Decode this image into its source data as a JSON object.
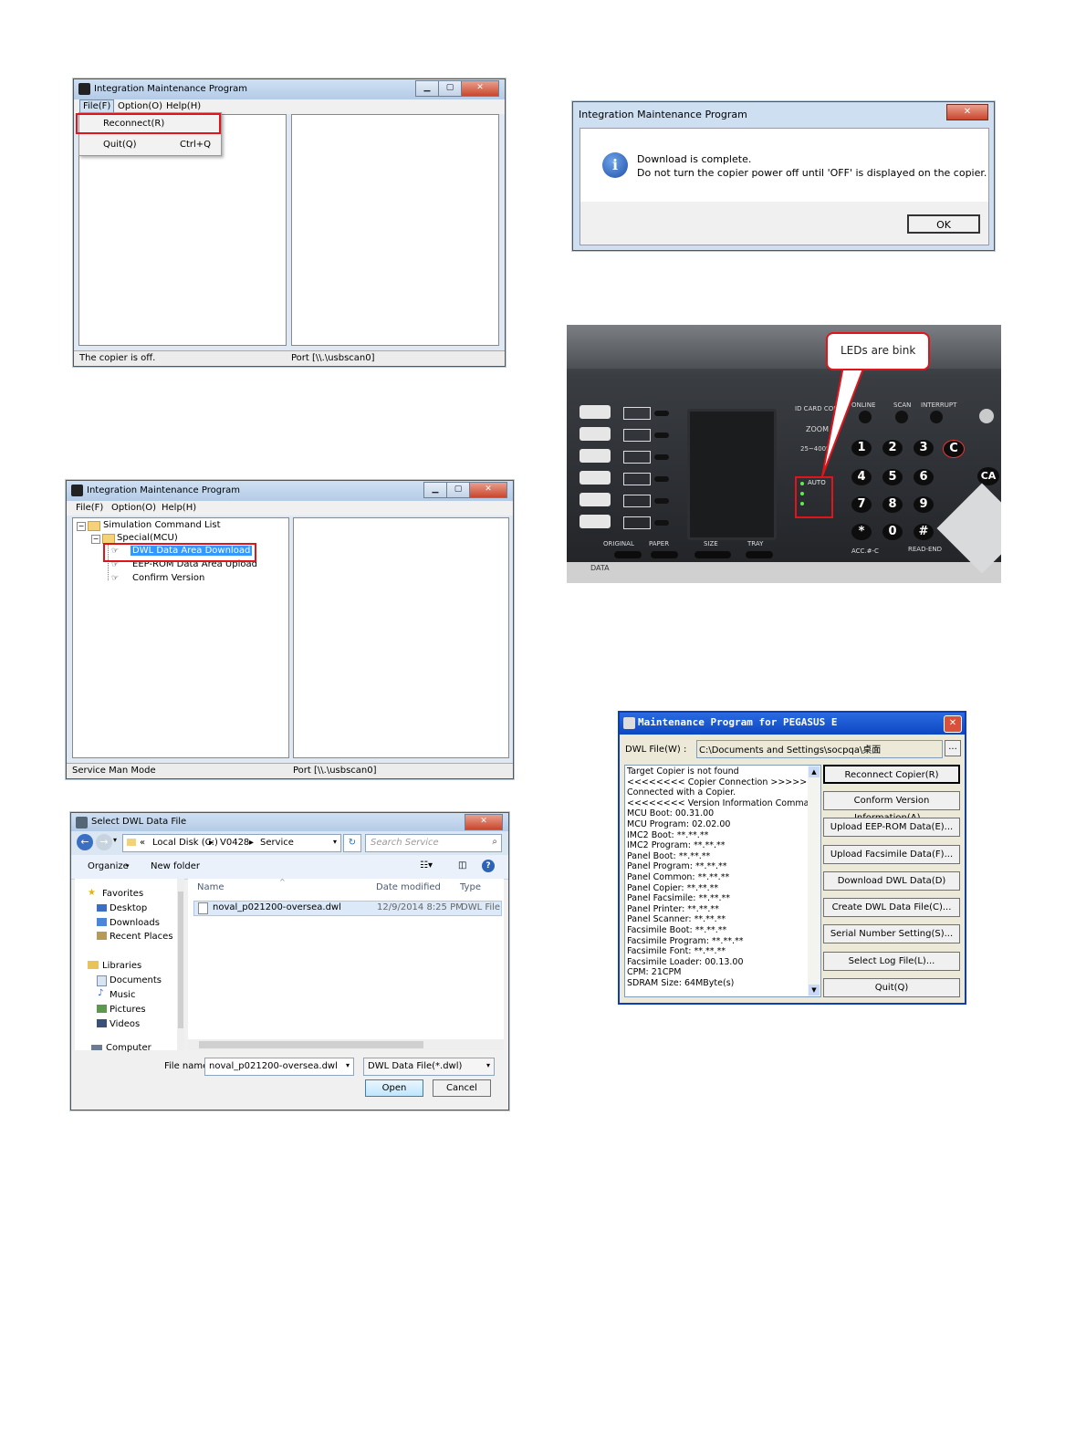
{
  "win1": {
    "title": "Integration Maintenance Program",
    "menu": {
      "file": "File(F)",
      "option": "Option(O)",
      "help": "Help(H)"
    },
    "dropdown": {
      "reconnect": "Reconnect(R)",
      "quit": "Quit(Q)",
      "quit_shortcut": "Ctrl+Q"
    },
    "status_left": "The copier is off.",
    "status_right": "Port [\\\\.\\usbscan0]"
  },
  "win2": {
    "title": "Integration Maintenance Program",
    "menu": {
      "file": "File(F)",
      "option": "Option(O)",
      "help": "Help(H)"
    },
    "tree": {
      "root": "Simulation Command List",
      "group": "Special(MCU)",
      "items": [
        "DWL Data Area Download",
        "EEP-ROM Data Area Upload",
        "Confirm Version"
      ]
    },
    "status_left": "Service Man Mode",
    "status_right": "Port [\\\\.\\usbscan0]"
  },
  "win3": {
    "title": "Select DWL Data File",
    "path": {
      "root": "«",
      "disk": "Local Disk (C:)",
      "folder1": "V0428",
      "folder2": "Service"
    },
    "search_placeholder": "Search Service",
    "organize": "Organize",
    "new_folder": "New folder",
    "nav": {
      "favorites": "Favorites",
      "favorite_items": [
        "Desktop",
        "Downloads",
        "Recent Places"
      ],
      "libraries": "Libraries",
      "library_items": [
        "Documents",
        "Music",
        "Pictures",
        "Videos"
      ],
      "computer": "Computer"
    },
    "columns": {
      "name": "Name",
      "date": "Date modified",
      "type": "Type"
    },
    "file": {
      "name": "noval_p021200-oversea.dwl",
      "date": "12/9/2014 8:25 PM",
      "type": "DWL File"
    },
    "file_name_label": "File name:",
    "file_name_value": "noval_p021200-oversea.dwl",
    "filter": "DWL Data File(*.dwl)",
    "open": "Open",
    "cancel": "Cancel"
  },
  "dialog": {
    "title": "Integration Maintenance Program",
    "line1": "Download is complete.",
    "line2": "Do not turn the copier power off until 'OFF' is displayed on the copier.",
    "ok": "OK"
  },
  "photo": {
    "callout": "LEDs are bink",
    "labels": {
      "id_card": "ID CARD COPY",
      "online": "ONLINE",
      "scan": "SCAN",
      "interrupt": "INTERRUPT",
      "zoom": "ZOOM",
      "zoom_range": "25~400%",
      "auto": "AUTO",
      "original": "ORIGINAL",
      "paper": "PAPER",
      "size": "SIZE",
      "tray": "TRAY",
      "acc": "ACC.#-C",
      "read_end": "READ-END",
      "data": "DATA"
    },
    "keys": [
      "1",
      "2",
      "3",
      "C",
      "4",
      "5",
      "6",
      "CA",
      "7",
      "8",
      "9",
      "*",
      "0",
      "#"
    ]
  },
  "pegasus": {
    "title": "Maintenance Program for PEGASUS E",
    "dwl_label": "DWL File(W) :",
    "dwl_path": "C:\\Documents and Settings\\socpqa\\桌面",
    "browse": "...",
    "log": [
      "Target Copier is not found",
      "<<<<<<<< Copier Connection >>>>>>>>",
      "Connected with a Copier.",
      "<<<<<<<< Version Information Command >>>>",
      "MCU Boot: 00.31.00",
      "MCU Program: 02.02.00",
      "IMC2 Boot: **.**.**",
      "IMC2 Program: **.**.**",
      "Panel Boot: **.**.**",
      "Panel Program: **.**.**",
      "Panel Common: **.**.**",
      "Panel Copier: **.**.**",
      "Panel Facsimile: **.**.**",
      "Panel Printer: **.**.**",
      "Panel Scanner: **.**.**",
      "Facsimile Boot: **.**.**",
      "Facsimile Program: **.**.**",
      "Facsimile Font: **.**.**",
      "Facsimile Loader: 00.13.00",
      "CPM: 21CPM",
      "SDRAM Size: 64MByte(s)"
    ],
    "buttons": [
      "Reconnect Copier(R)",
      "Conform Version Information(A)...",
      "Upload EEP-ROM Data(E)...",
      "Upload Facsimile Data(F)...",
      "Download DWL Data(D)",
      "Create DWL Data File(C)...",
      "Serial Number Setting(S)...",
      "Select Log File(L)...",
      "Quit(Q)"
    ]
  }
}
